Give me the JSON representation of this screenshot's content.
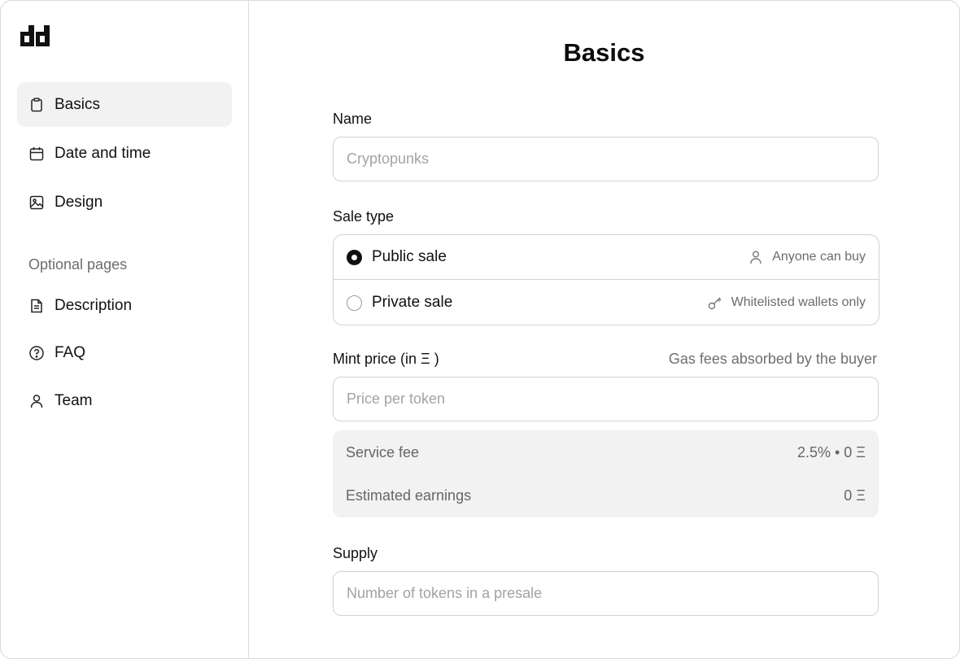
{
  "sidebar": {
    "logo_icon": "dd-logo-icon",
    "items": [
      {
        "label": "Basics",
        "icon": "clipboard-icon",
        "active": true
      },
      {
        "label": "Date and time",
        "icon": "calendar-icon",
        "active": false
      },
      {
        "label": "Design",
        "icon": "image-icon",
        "active": false
      }
    ],
    "optional_label": "Optional pages",
    "optional_items": [
      {
        "label": "Description",
        "icon": "document-icon"
      },
      {
        "label": "FAQ",
        "icon": "question-circle-icon"
      },
      {
        "label": "Team",
        "icon": "user-icon"
      }
    ]
  },
  "main": {
    "title": "Basics",
    "name": {
      "label": "Name",
      "placeholder": "Cryptopunks",
      "value": ""
    },
    "sale_type": {
      "label": "Sale type",
      "options": [
        {
          "label": "Public sale",
          "hint": "Anyone can buy",
          "hint_icon": "user-icon",
          "selected": true
        },
        {
          "label": "Private sale",
          "hint": "Whitelisted wallets only",
          "hint_icon": "key-icon",
          "selected": false
        }
      ]
    },
    "mint_price": {
      "label": "Mint price (in Ξ )",
      "hint": "Gas fees absorbed by the buyer",
      "placeholder": "Price per token",
      "value": ""
    },
    "fees": {
      "service_fee_label": "Service fee",
      "service_fee_value": "2.5% • 0 Ξ",
      "earnings_label": "Estimated earnings",
      "earnings_value": "0 Ξ"
    },
    "supply": {
      "label": "Supply",
      "placeholder": "Number of tokens in a presale",
      "value": ""
    }
  },
  "colors": {
    "active_bg": "#f1f2f1",
    "border": "#d2d2d2",
    "muted_text": "#6c6c6c",
    "selected_radio": "#111111"
  }
}
